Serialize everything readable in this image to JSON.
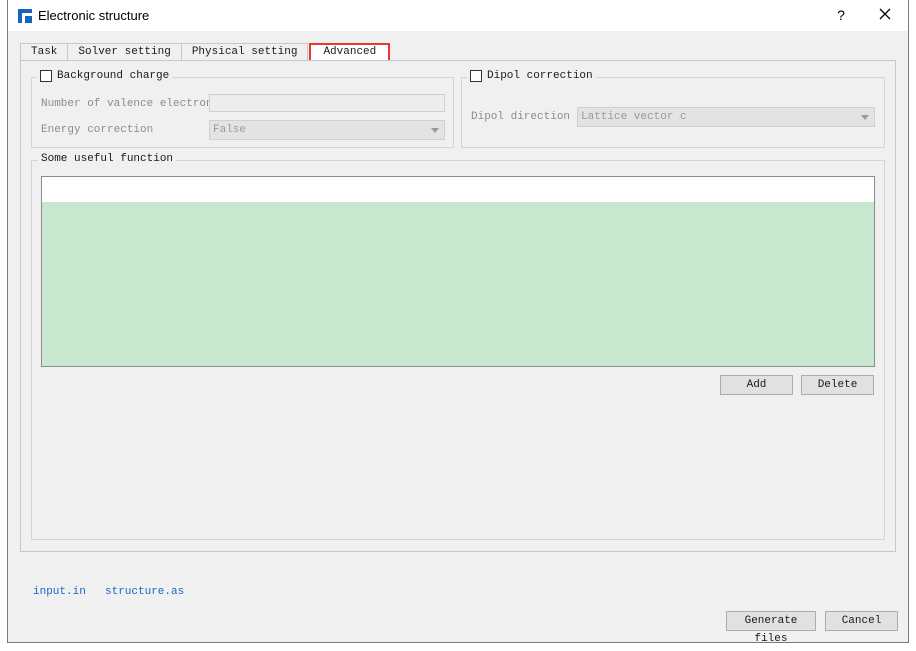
{
  "window": {
    "title": "Electronic structure",
    "help": "?"
  },
  "tabs": [
    {
      "label": "Task"
    },
    {
      "label": "Solver setting"
    },
    {
      "label": "Physical setting"
    },
    {
      "label": "Advanced"
    }
  ],
  "background_charge": {
    "title": "Background charge",
    "valence_label": "Number of valence electrons",
    "valence_value": "",
    "energy_label": "Energy correction",
    "energy_value": "False"
  },
  "dipol_correction": {
    "title": "Dipol correction",
    "direction_label": "Dipol direction",
    "direction_value": "Lattice vector c"
  },
  "useful_function": {
    "title": "Some useful function",
    "add_label": "Add",
    "delete_label": "Delete"
  },
  "files": {
    "input": "input.in",
    "structure": "structure.as"
  },
  "footer": {
    "generate_label": "Generate files",
    "cancel_label": "Cancel"
  }
}
